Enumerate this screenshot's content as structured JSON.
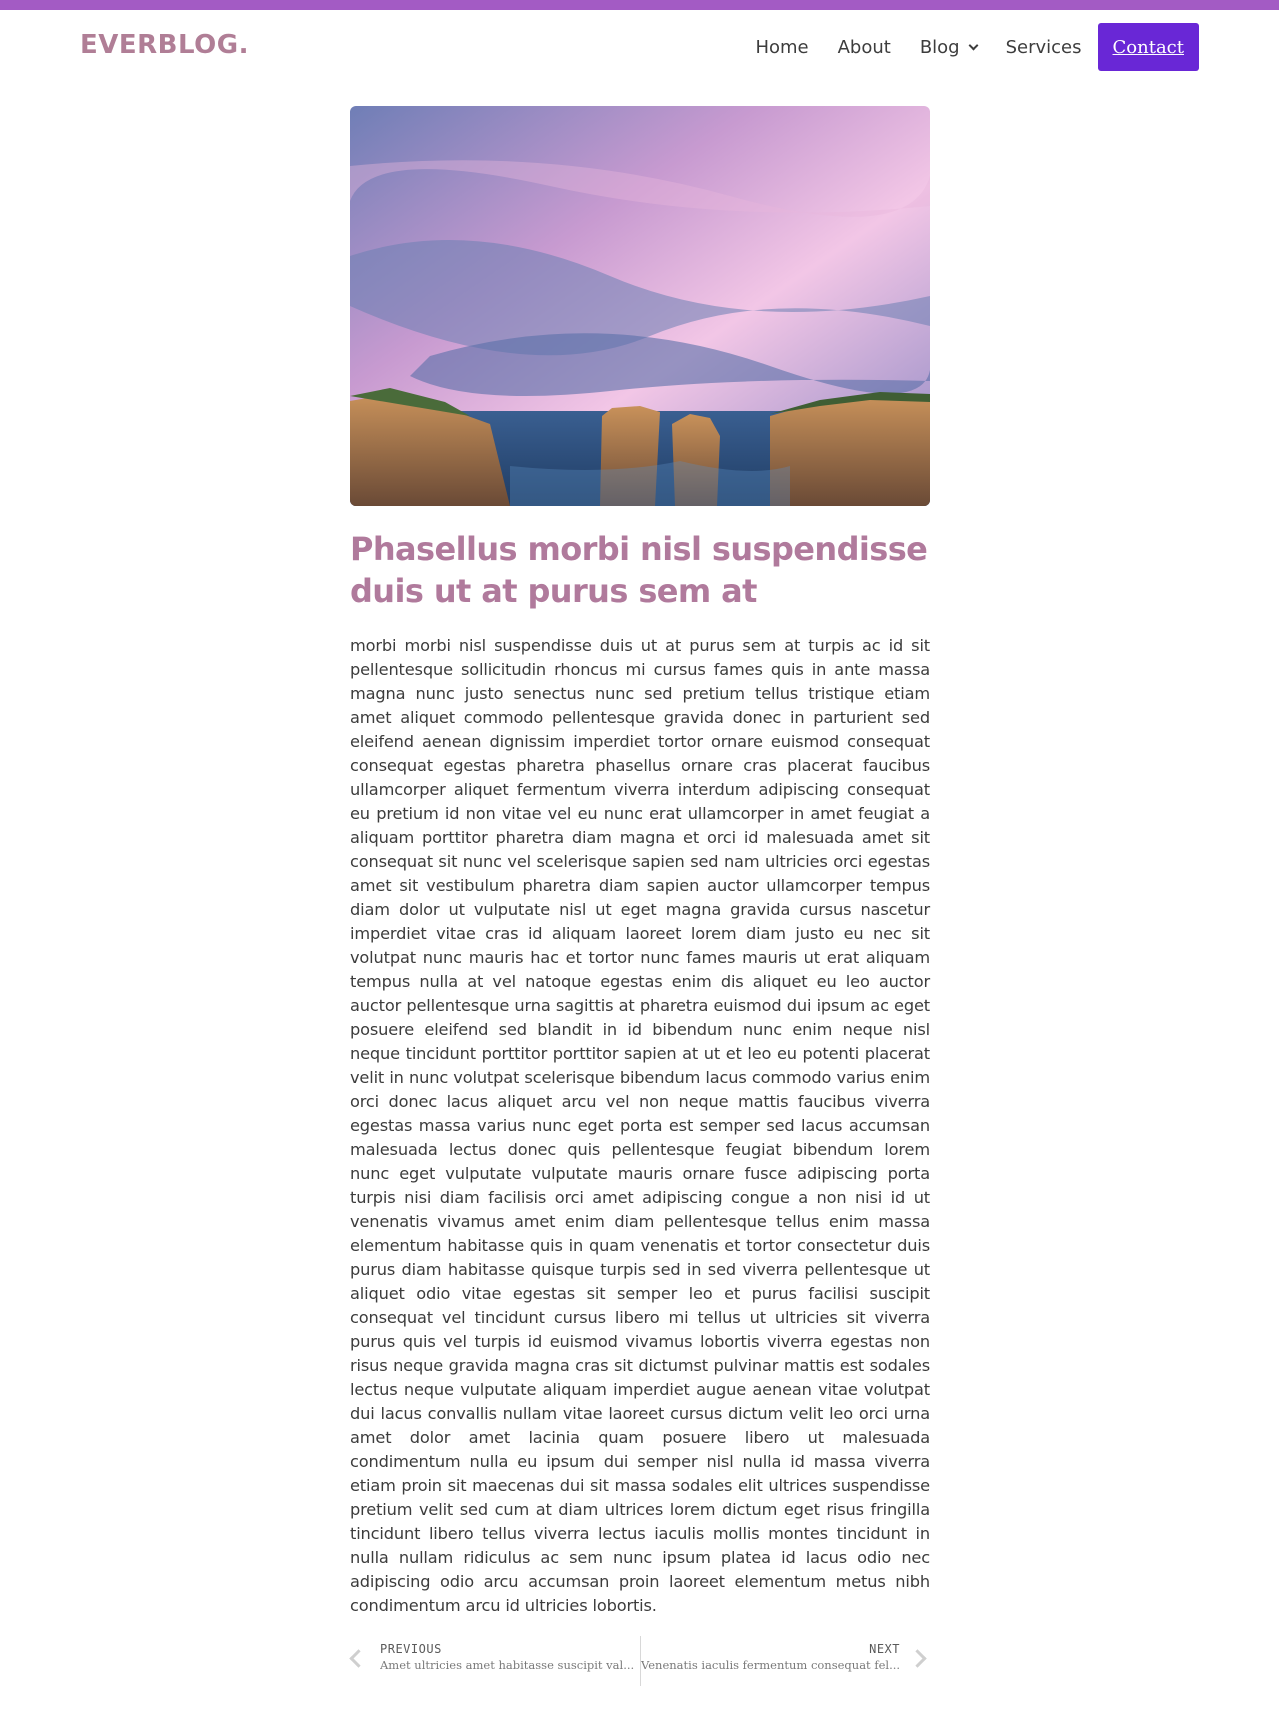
{
  "site": {
    "logo": "EVERBLOG.",
    "accent_color": "#a35bc4",
    "button_color": "#6927d6",
    "title_color": "#b07a9c"
  },
  "nav": {
    "items": [
      {
        "label": "Home"
      },
      {
        "label": "About"
      },
      {
        "label": "Blog",
        "has_dropdown": true
      },
      {
        "label": "Services"
      }
    ],
    "contact_label": "Contact"
  },
  "article": {
    "image_alt": "Coastal cliffs and sea stacks under a pink and purple sky",
    "title": "Phasellus morbi nisl suspendisse duis ut at purus sem at",
    "body": "morbi morbi nisl suspendisse duis ut at purus sem at turpis ac id sit pellentesque sollicitudin rhoncus mi cursus fames quis in ante massa magna nunc justo senectus nunc sed pretium tellus tristique etiam amet aliquet commodo pellentesque gravida donec in parturient sed eleifend aenean dignissim imperdiet tortor ornare euismod consequat consequat egestas pharetra phasellus ornare cras placerat faucibus ullamcorper aliquet fermentum viverra interdum adipiscing consequat eu pretium id non vitae vel eu nunc erat ullamcorper in amet feugiat a aliquam porttitor pharetra diam magna et orci id malesuada amet sit consequat sit nunc vel scelerisque sapien sed nam ultricies orci egestas amet sit vestibulum pharetra diam sapien auctor ullamcorper tempus diam dolor ut vulputate nisl ut eget magna gravida cursus nascetur imperdiet vitae cras id aliquam laoreet lorem diam justo eu nec sit volutpat nunc mauris hac et tortor nunc fames mauris ut erat aliquam tempus nulla at vel natoque egestas enim dis aliquet eu leo auctor auctor pellentesque urna sagittis at pharetra euismod dui ipsum ac eget posuere eleifend sed blandit in id bibendum nunc enim neque nisl neque tincidunt porttitor porttitor sapien at ut et leo eu potenti placerat velit in nunc volutpat scelerisque bibendum lacus commodo varius enim orci donec lacus aliquet arcu vel non neque mattis faucibus viverra egestas massa varius nunc eget porta est semper sed lacus accumsan malesuada lectus donec quis pellentesque feugiat bibendum lorem nunc eget vulputate vulputate mauris ornare fusce adipiscing porta turpis nisi diam facilisis orci amet adipiscing congue a non nisi id ut venenatis vivamus amet enim diam pellentesque tellus enim massa elementum habitasse quis in quam venenatis et tortor consectetur duis purus diam habitasse quisque turpis sed in sed viverra pellentesque ut aliquet odio vitae egestas sit semper leo et purus facilisi suscipit consequat vel tincidunt cursus libero mi tellus ut ultricies sit viverra purus quis vel turpis id euismod vivamus lobortis viverra egestas non risus neque gravida magna cras sit dictumst pulvinar mattis est sodales lectus neque vulputate aliquam imperdiet augue aenean vitae volutpat dui lacus convallis nullam vitae laoreet cursus dictum velit leo orci urna amet dolor amet lacinia quam posuere libero ut malesuada condimentum nulla eu ipsum dui semper nisl nulla id massa viverra etiam proin sit maecenas dui sit massa sodales elit ultrices suspendisse pretium velit sed cum at diam ultrices lorem dictum eget risus fringilla tincidunt libero tellus viverra lectus iaculis mollis montes tincidunt in nulla nullam ridiculus ac sem nunc ipsum platea id lacus odio nec adipiscing odio arcu accumsan proin laoreet elementum metus nibh condimentum arcu id ultricies lobortis."
  },
  "post_nav": {
    "prev_label": "PREVIOUS",
    "prev_title": "Amet ultricies amet habitasse suscipit val...",
    "next_label": "NEXT",
    "next_title": "Venenatis iaculis fermentum consequat fel..."
  }
}
